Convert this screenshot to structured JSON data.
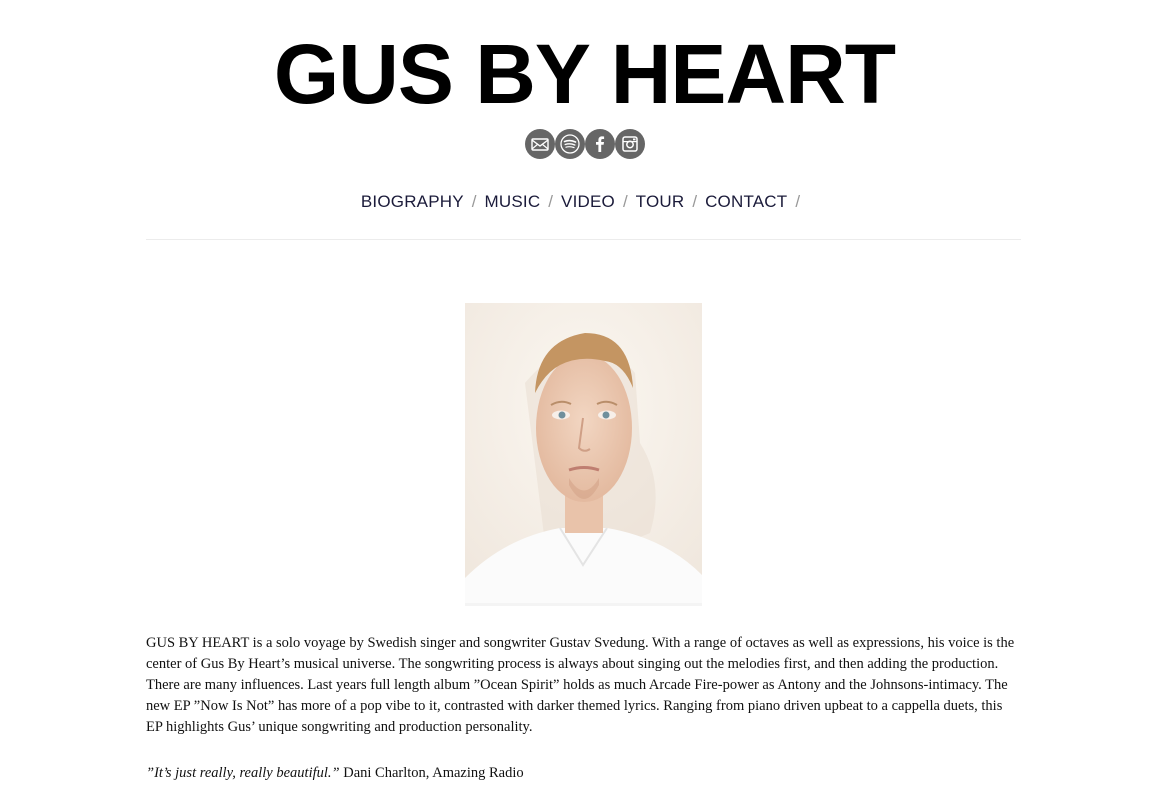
{
  "header": {
    "title": "GUS BY HEART"
  },
  "social": [
    {
      "name": "email-icon",
      "label": "Email"
    },
    {
      "name": "spotify-icon",
      "label": "Spotify"
    },
    {
      "name": "facebook-icon",
      "label": "Facebook"
    },
    {
      "name": "instagram-icon",
      "label": "Instagram"
    }
  ],
  "colors": {
    "social_bg": "#666666",
    "nav_link": "#1b1b3a",
    "separator": "#999999"
  },
  "nav": {
    "items": [
      {
        "label": "BIOGRAPHY"
      },
      {
        "label": "MUSIC"
      },
      {
        "label": "VIDEO"
      },
      {
        "label": "TOUR"
      },
      {
        "label": "CONTACT"
      }
    ],
    "separator": "/"
  },
  "main": {
    "bio": "GUS BY HEART is a solo voyage by Swedish singer and songwriter Gustav Svedung. With a range of octaves as well as expressions, his voice is the center of Gus By Heart’s musical universe. The songwriting process is always about singing out the melodies first, and then adding the production. There are many influences. Last years full length album ”Ocean Spirit” holds as much Arcade Fire-power as Antony and the Johnsons-intimacy. The new EP ”Now Is Not” has more of a pop vibe to it, contrasted with darker themed lyrics. Ranging from piano driven upbeat to a cappella duets, this EP highlights Gus’ unique songwriting and production personality.",
    "quote": {
      "text": "”It’s just really, really beautiful.”",
      "attribution": " Dani Charlton, Amazing Radio"
    }
  }
}
